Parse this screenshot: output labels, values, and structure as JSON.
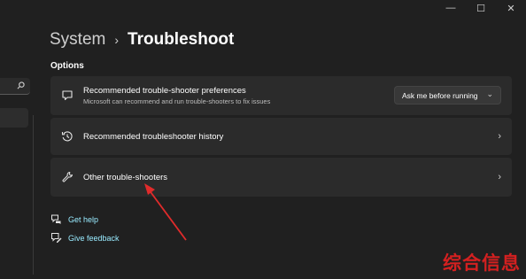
{
  "window": {
    "minimize_glyph": "—",
    "maximize_glyph": "☐",
    "close_glyph": "✕"
  },
  "breadcrumb": {
    "parent": "System",
    "separator": "›",
    "current": "Troubleshoot"
  },
  "section_label": "Options",
  "cards": [
    {
      "title": "Recommended trouble-shooter preferences",
      "description": "Microsoft can recommend and run trouble-shooters to fix issues",
      "icon": "chat-bubble-icon",
      "dropdown_value": "Ask me before running",
      "dropdown_chevron": "⌄"
    },
    {
      "title": "Recommended troubleshooter history",
      "icon": "history-icon",
      "chevron": "›"
    },
    {
      "title": "Other trouble-shooters",
      "icon": "wrench-icon",
      "chevron": "›"
    }
  ],
  "links": [
    {
      "label": "Get help",
      "icon": "help-icon"
    },
    {
      "label": "Give feedback",
      "icon": "feedback-icon"
    }
  ],
  "watermark": "综合信息",
  "colors": {
    "background": "#202020",
    "card": "#2b2b2b",
    "link": "#99ebff",
    "arrow": "#e02b2b"
  }
}
